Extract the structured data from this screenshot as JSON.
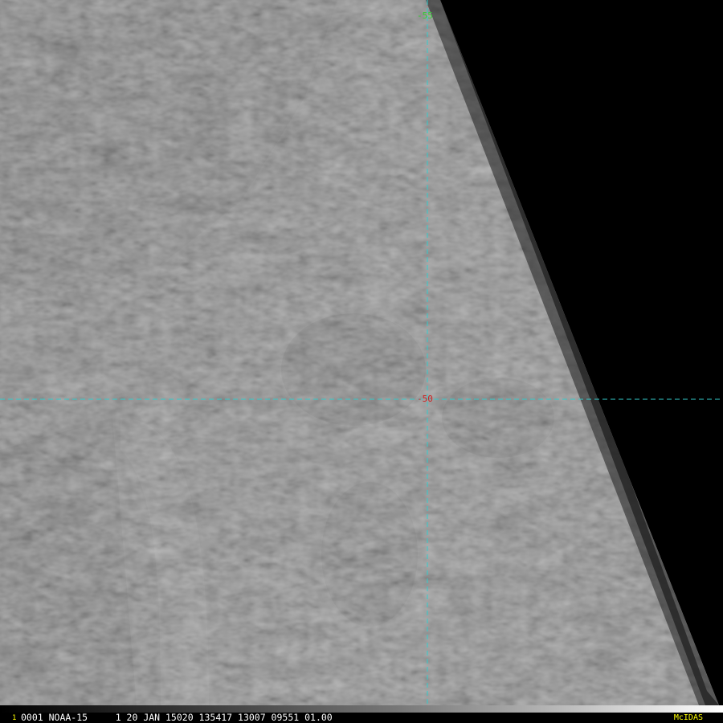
{
  "grid_labels": {
    "longitude": "-55",
    "latitude": "-50"
  },
  "footer": {
    "frame_number": "1",
    "header_line": "0001 NOAA-15     1 20 JAN 15020 135417 13007 09551 01.00",
    "software": "McIDAS"
  },
  "colors": {
    "grid_line": "#33cccc",
    "lon_label": "#33cc33",
    "lat_label": "#cc2222",
    "frame_number": "#ffff00",
    "software": "#ffff00",
    "space": "#000000"
  }
}
